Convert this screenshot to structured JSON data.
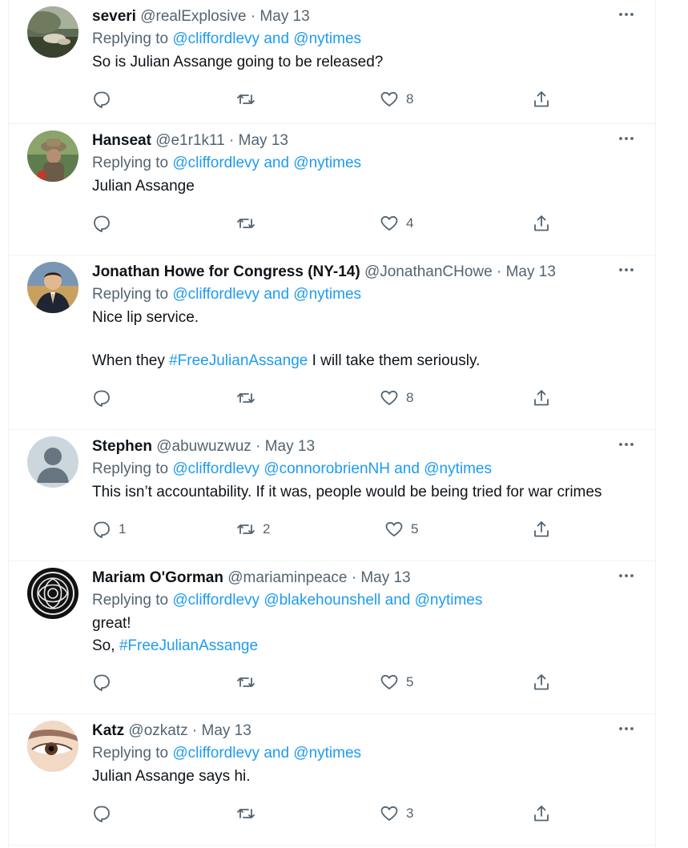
{
  "tweets": [
    {
      "name": "severi",
      "handle": "@realExplosive",
      "date": "May 13",
      "reply_prefix": "Replying to",
      "reply_to": "@cliffordlevy and @nytimes",
      "body": [
        "So is Julian Assange going to be released?"
      ],
      "replies": "",
      "retweets": "",
      "likes": "8"
    },
    {
      "name": "Hanseat",
      "handle": "@e1r1k11",
      "date": "May 13",
      "reply_prefix": "Replying to",
      "reply_to": "@cliffordlevy and @nytimes",
      "body": [
        "Julian Assange"
      ],
      "replies": "",
      "retweets": "",
      "likes": "4"
    },
    {
      "name": "Jonathan Howe for Congress (NY-14)",
      "handle": "@JonathanCHowe",
      "date": "May 13",
      "reply_prefix": "Replying to",
      "reply_to": "@cliffordlevy and @nytimes",
      "body": [
        "Nice lip service.",
        "",
        "When they ",
        "#FreeJulianAssange",
        " I will take them seriously."
      ],
      "replies": "",
      "retweets": "",
      "likes": "8"
    },
    {
      "name": "Stephen",
      "handle": "@abuwuzwuz",
      "date": "May 13",
      "reply_prefix": "Replying to",
      "reply_to": "@cliffordlevy @connorobrienNH and @nytimes",
      "body": [
        "This isn’t accountability. If it was, people would be being tried for war crimes"
      ],
      "replies": "1",
      "retweets": "2",
      "likes": "5"
    },
    {
      "name": "Mariam O'Gorman",
      "handle": "@mariaminpeace",
      "date": "May 13",
      "reply_prefix": "Replying to",
      "reply_to": "@cliffordlevy @blakehounshell and @nytimes",
      "body": [
        "great!",
        "So, ",
        "#FreeJulianAssange"
      ],
      "replies": "",
      "retweets": "",
      "likes": "5"
    },
    {
      "name": "Katz",
      "handle": "@ozkatz",
      "date": "May 13",
      "reply_prefix": "Replying to",
      "reply_to": "@cliffordlevy and @nytimes",
      "body": [
        "Julian Assange says hi."
      ],
      "replies": "",
      "retweets": "",
      "likes": "3"
    }
  ],
  "icons": {
    "reply": "reply-icon",
    "retweet": "retweet-icon",
    "like": "heart-icon",
    "share": "share-icon",
    "more": "more-icon"
  },
  "colors": {
    "link": "#1d9bf0",
    "secondary_text": "#536471",
    "primary_text": "#0f1419",
    "divider": "#eff3f4"
  }
}
